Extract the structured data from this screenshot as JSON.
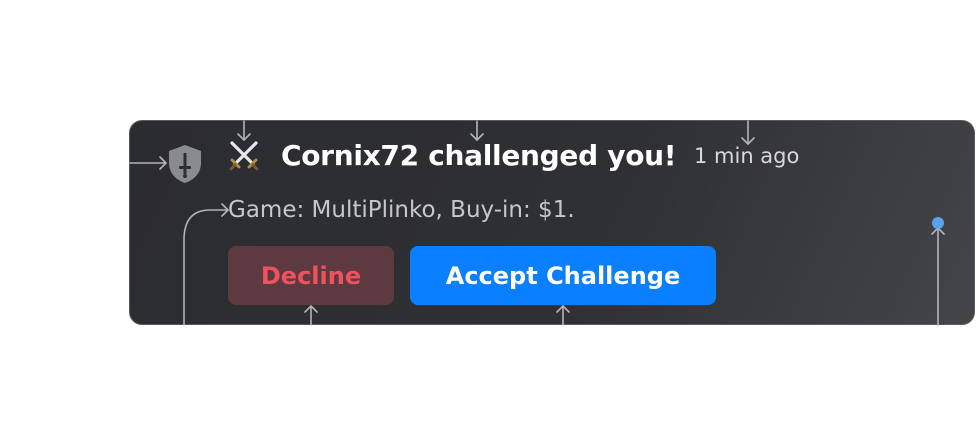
{
  "notification": {
    "title": "Cornix72 challenged you!",
    "timestamp": "1 min ago",
    "details": "Game: MultiPlinko, Buy-in: $1.",
    "shield_icon": "shield-sword-icon",
    "swords_icon": "crossed-swords-icon"
  },
  "actions": {
    "decline_label": "Decline",
    "accept_label": "Accept Challenge"
  },
  "colors": {
    "card_background": "#2f3034",
    "accept_button": "#0a7fff",
    "decline_button_bg": "#5c3a40",
    "decline_text": "#ee5261",
    "annotation_dot": "#5aa2f0",
    "annotation_arrow": "#b4b4b8"
  }
}
